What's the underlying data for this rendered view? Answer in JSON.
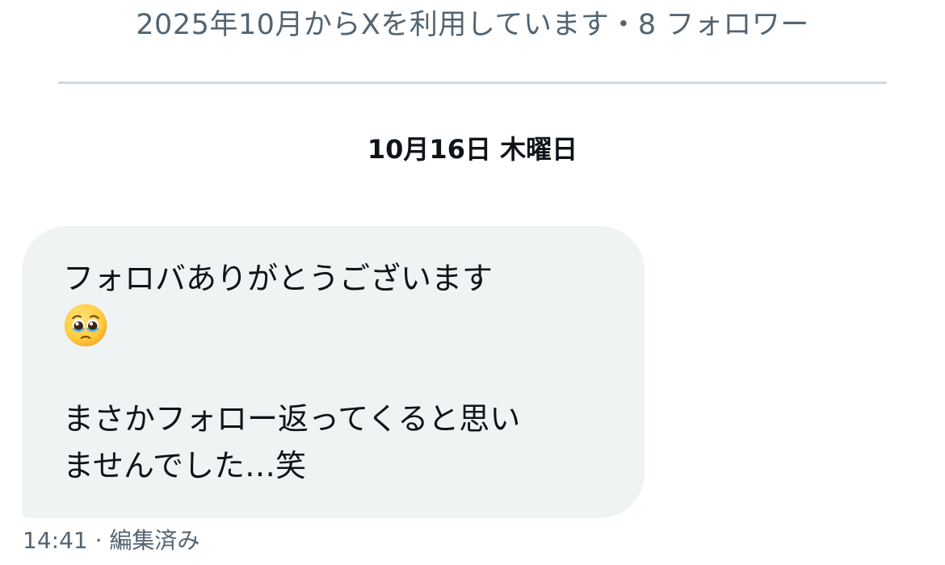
{
  "profile": {
    "meta_text": "2025年10月からXを利用しています・8 フォロワー"
  },
  "conversation": {
    "date_header": "10月16日 木曜日"
  },
  "message": {
    "line1": "フォロバありがとうございます",
    "emoji": "pleading-face",
    "line2": "まさかフォロー返ってくると思い",
    "line3": "ませんでした…笑",
    "time": "14:41",
    "separator": " · ",
    "status": "編集済み"
  },
  "colors": {
    "bubble_background": "#eff3f4",
    "secondary_text": "#536471",
    "primary_text": "#0f1419",
    "divider": "#cfd9de"
  }
}
